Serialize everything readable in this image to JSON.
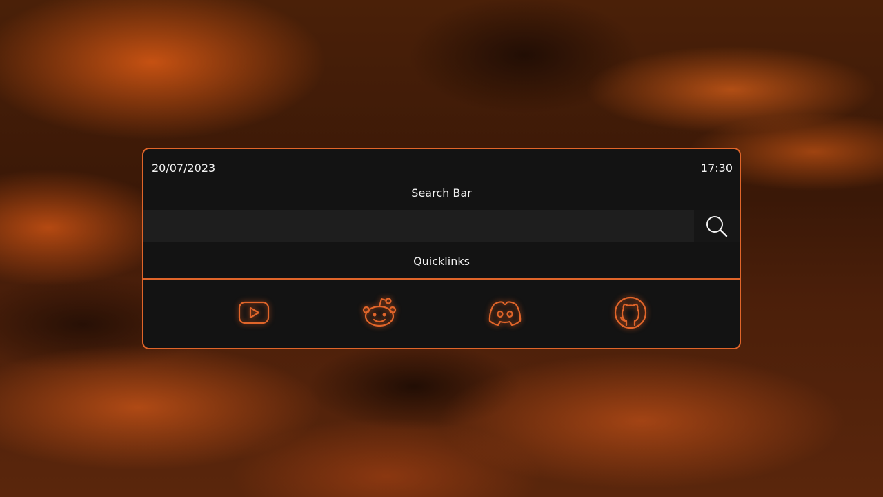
{
  "panel": {
    "date": "20/07/2023",
    "time": "17:30",
    "search_title": "Search Bar",
    "search_placeholder": "",
    "quicklinks_title": "Quicklinks"
  },
  "quicklinks": [
    {
      "icon": "youtube-icon"
    },
    {
      "icon": "reddit-icon"
    },
    {
      "icon": "discord-icon"
    },
    {
      "icon": "github-icon"
    }
  ],
  "colors": {
    "accent": "#e0652a",
    "panel_bg": "#131313",
    "input_bg": "#1e1e1e",
    "text": "#f2f2f2"
  }
}
